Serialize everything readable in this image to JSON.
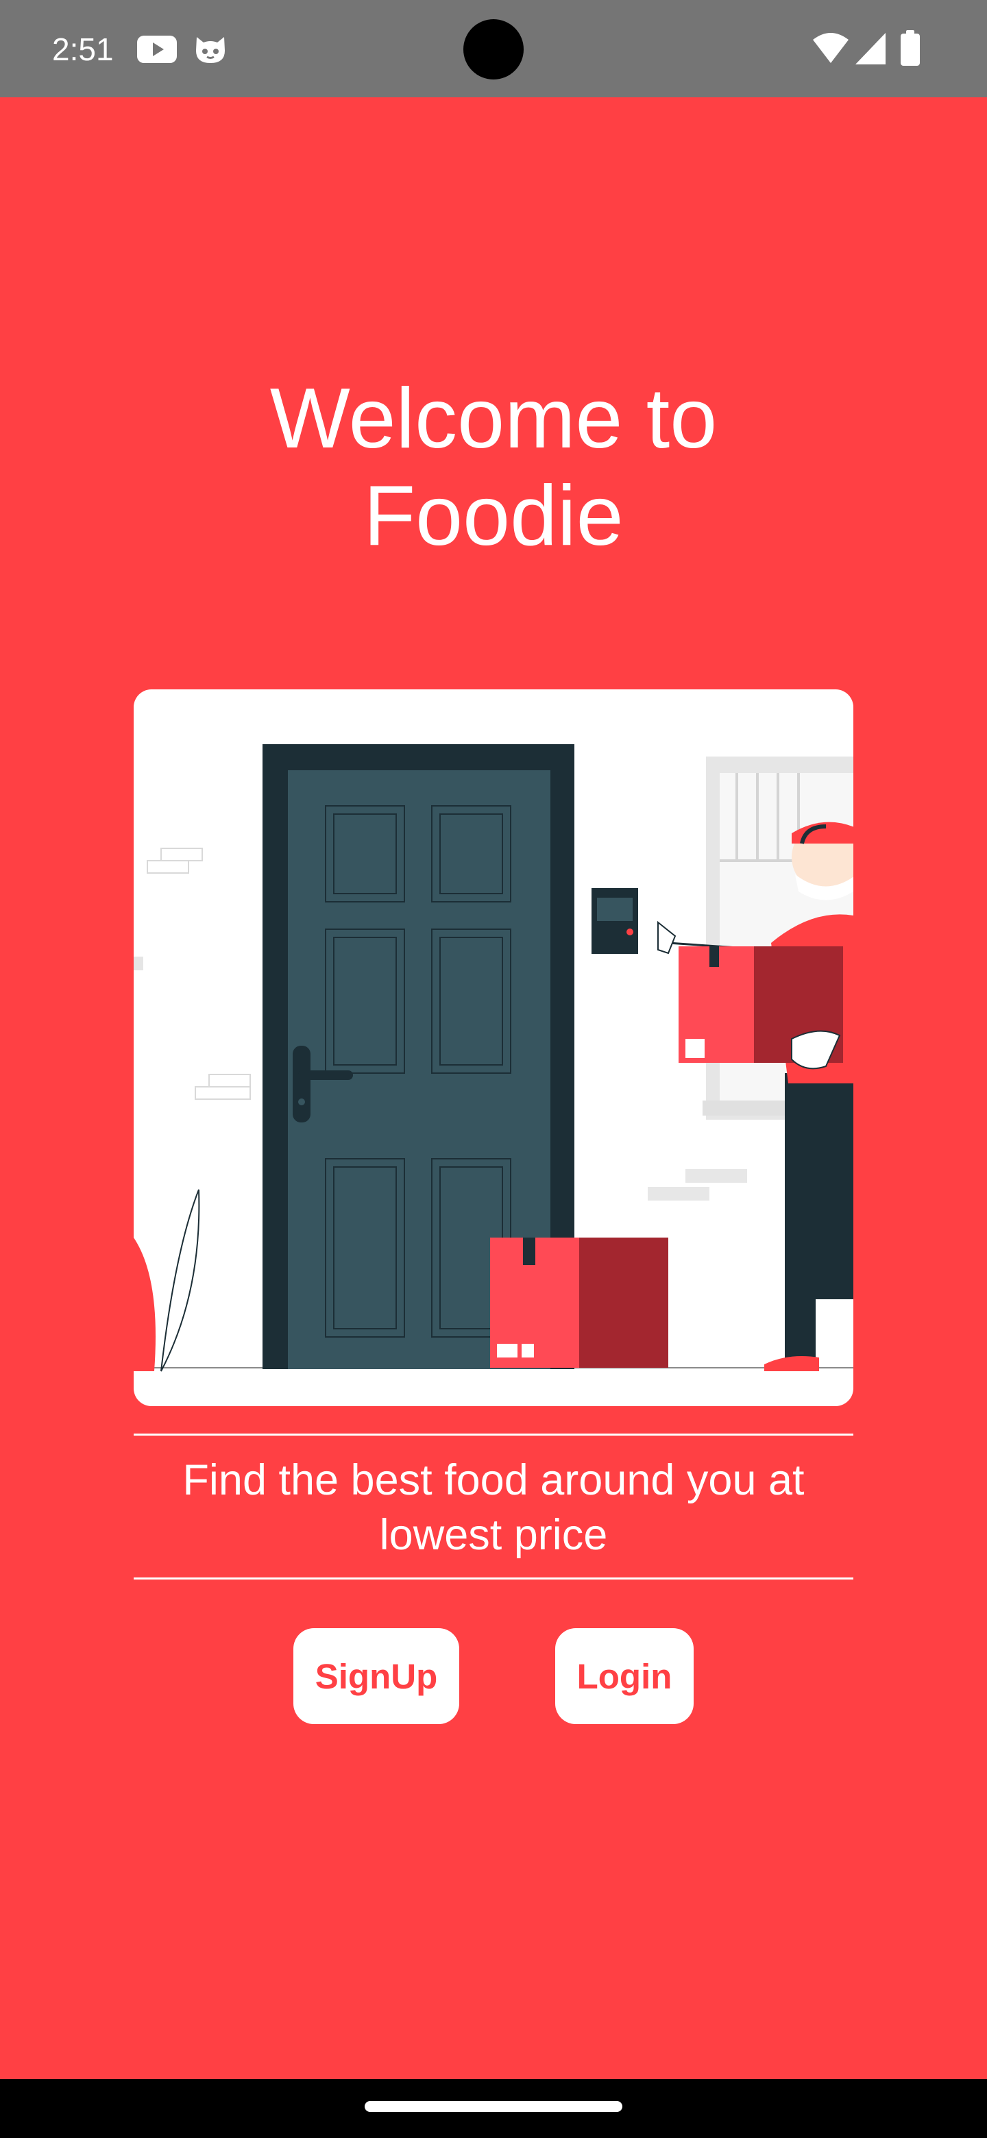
{
  "status_bar": {
    "time": "2:51",
    "left_icons": [
      "youtube-icon",
      "cat-face-icon"
    ],
    "right_icons": [
      "wifi-icon",
      "cellular-signal-icon",
      "battery-icon"
    ],
    "background_color": "#757575"
  },
  "welcome": {
    "title": "Welcome to\nFoodie"
  },
  "illustration": {
    "description_icon": "delivery-person-at-door-illustration"
  },
  "tagline": {
    "text": "Find the best food around you at lowest price"
  },
  "buttons": {
    "signup_label": "SignUp",
    "login_label": "Login"
  },
  "theme": {
    "accent": "#ff4044",
    "surface": "#ffffff",
    "door": "#37555f",
    "door_frame": "#1c2e36"
  }
}
